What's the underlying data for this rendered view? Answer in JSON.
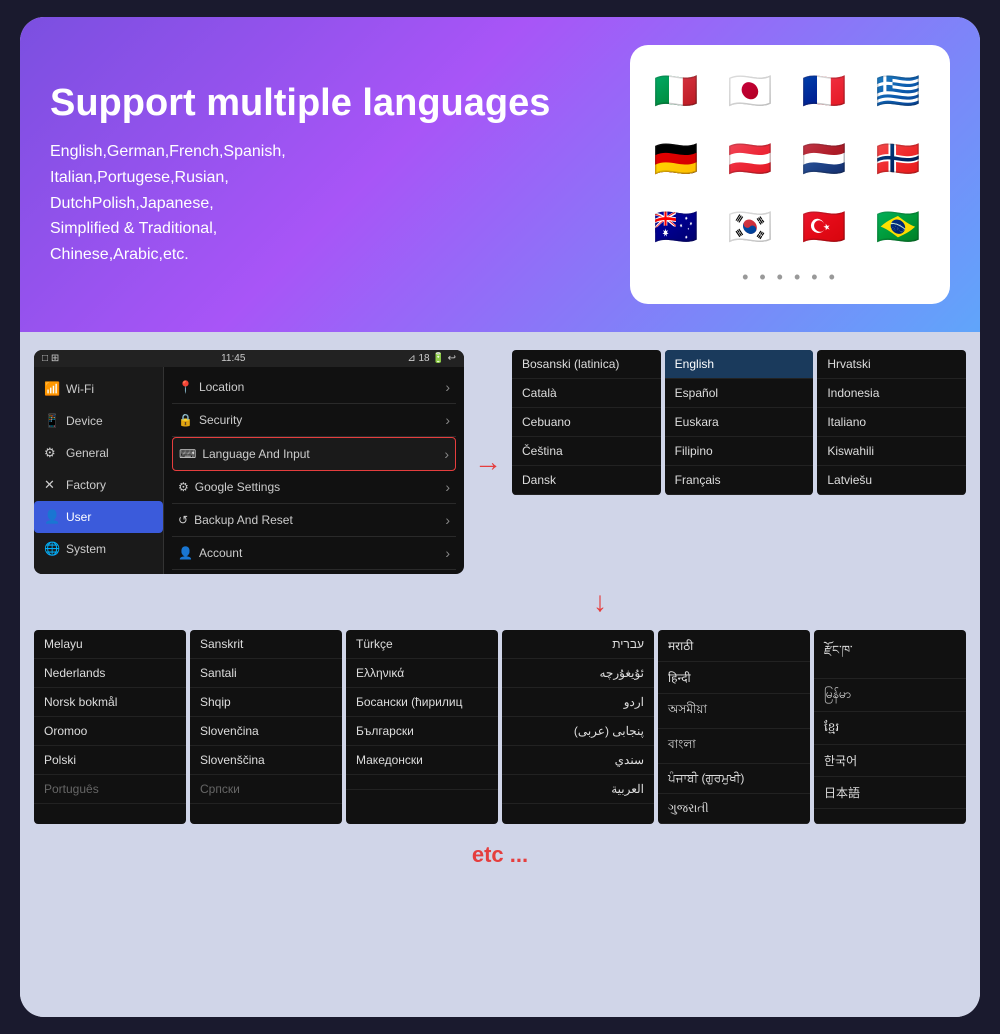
{
  "banner": {
    "title": "Support multiple languages",
    "subtitle": "English,German,French,Spanish,\nItalian,Portugese,Rusian,\nDutchPolish,Japanese,\nSimplified & Traditional,\nChinese,Arabic,etc.",
    "flags": [
      "🇮🇹",
      "🇯🇵",
      "🇫🇷",
      "🇬🇷",
      "🇩🇪",
      "🇦🇹",
      "🇳🇱",
      "🇳🇴",
      "🇦🇺",
      "🇰🇷",
      "🇹🇷",
      "🇧🇷"
    ],
    "dots": "• • • • • •"
  },
  "android": {
    "status_time": "11:45",
    "status_icons": "⊿ 18 🔋 ↩",
    "menu_items": [
      {
        "icon": "📶",
        "label": "Wi-Fi"
      },
      {
        "icon": "📱",
        "label": "Device"
      },
      {
        "icon": "⚙",
        "label": "General"
      },
      {
        "icon": "✕",
        "label": "Factory",
        "state": "normal"
      },
      {
        "icon": "👤",
        "label": "User",
        "state": "selected"
      },
      {
        "icon": "🌐",
        "label": "System"
      }
    ],
    "settings": [
      {
        "icon": "📍",
        "label": "Location"
      },
      {
        "icon": "🔒",
        "label": "Security"
      },
      {
        "icon": "⌨",
        "label": "Language And Input",
        "highlighted": true
      },
      {
        "icon": "⚙",
        "label": "Google Settings"
      },
      {
        "icon": "↺",
        "label": "Backup And Reset"
      },
      {
        "icon": "👤",
        "label": "Account"
      }
    ]
  },
  "lang_columns_right": [
    {
      "items": [
        "Bosanski (latinica)",
        "Català",
        "Cebuano",
        "Čeština",
        "Dansk"
      ]
    },
    {
      "items": [
        "English",
        "Español",
        "Euskara",
        "Filipino",
        "Français"
      ]
    },
    {
      "items": [
        "Hrvatski",
        "Indonesia",
        "Italiano",
        "Kiswahili",
        "Latviešu"
      ]
    }
  ],
  "lang_columns_bottom": [
    {
      "items": [
        "Melayu",
        "Nederlands",
        "Norsk bokmål",
        "Oromoo",
        "Polski",
        "Português"
      ]
    },
    {
      "items": [
        "Sanskrit",
        "Santali",
        "Shqip",
        "Slovenčina",
        "Slovenščina",
        "Српски"
      ]
    },
    {
      "items": [
        "Türkçe",
        "Ελληνικά",
        "Босански (ћирилиц",
        "Български",
        "Македонски",
        ""
      ]
    },
    {
      "items": [
        "עברית",
        "ئۇيغۇرچە",
        "اردو",
        "پنجابی (عربی)",
        "سندي",
        "العربية"
      ]
    },
    {
      "items": [
        "मराठी",
        "हिन्दी",
        "অসমীয়া",
        "বাংলা",
        "ਪੰਜਾਬੀ (ਗੁਰਮੁਖੀ)",
        "ગુજરાતી"
      ]
    },
    {
      "items": [
        "རྫོང་ཁ་",
        "မြန်မာ",
        "ខ្មែរ",
        "한국어",
        "日本語",
        ""
      ]
    }
  ],
  "etc_label": "etc ..."
}
